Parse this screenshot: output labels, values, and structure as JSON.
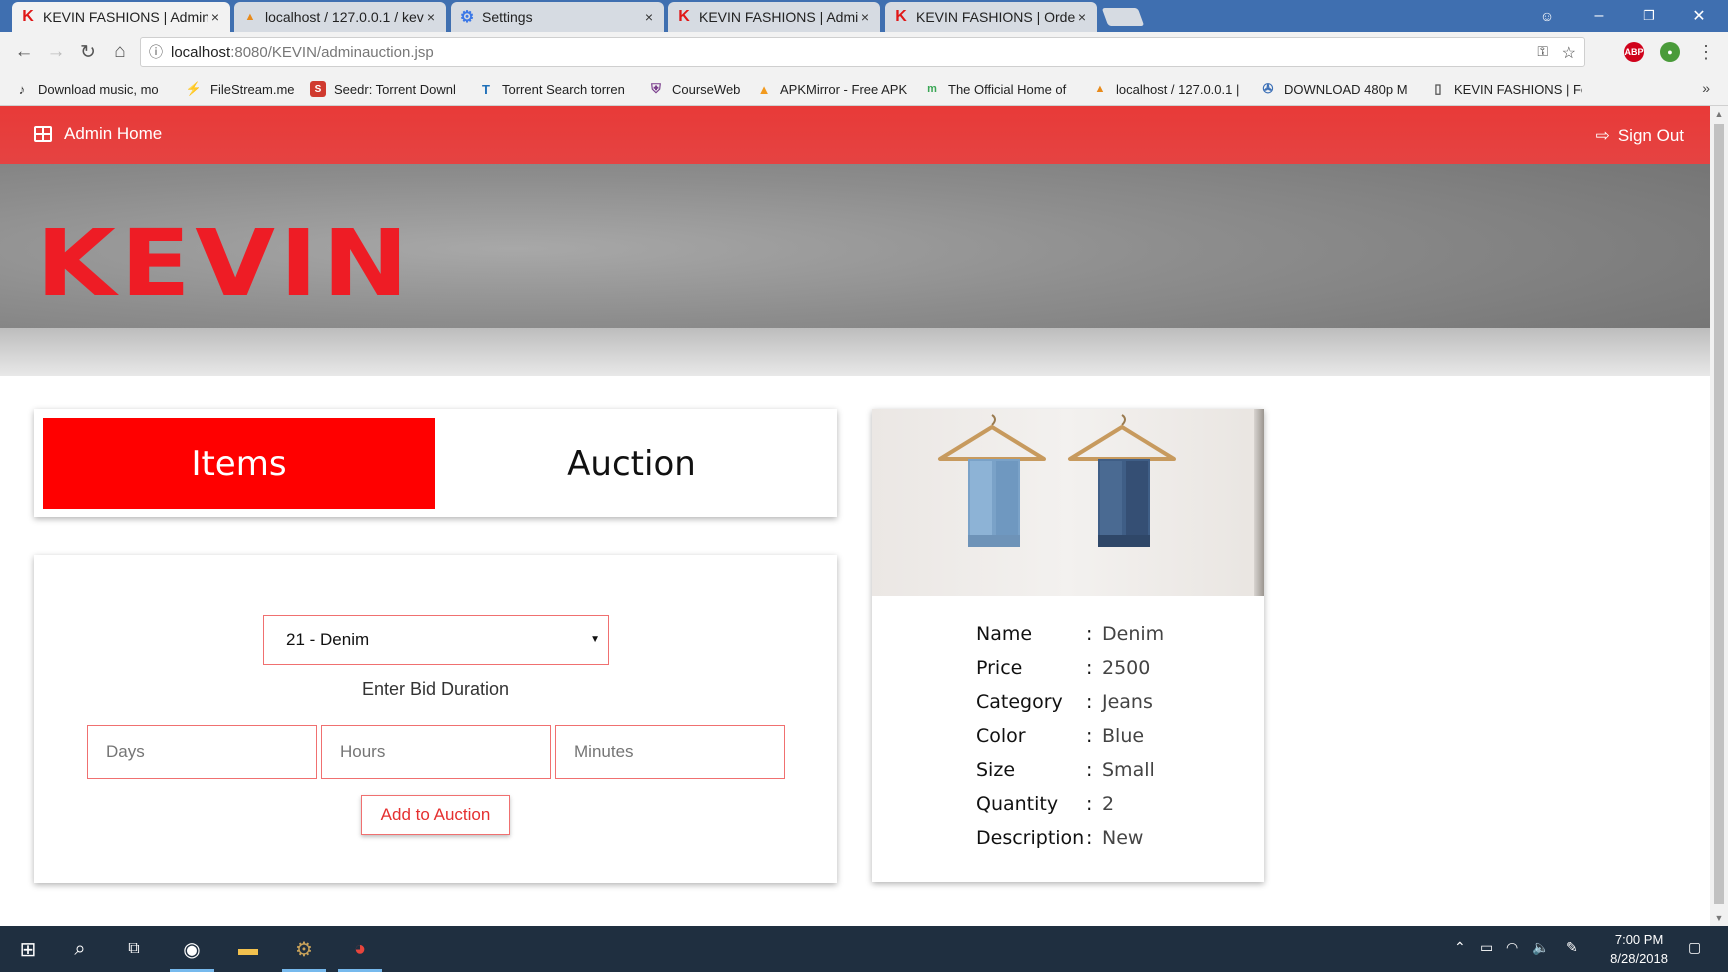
{
  "browser": {
    "tabs": [
      {
        "icon": "kevin-k-icon",
        "label": "KEVIN FASHIONS | Admin",
        "active": true
      },
      {
        "icon": "phpmyadmin-icon",
        "label": "localhost / 127.0.0.1 / kev",
        "active": false
      },
      {
        "icon": "gear-icon",
        "label": "Settings",
        "active": false
      },
      {
        "icon": "kevin-k-icon",
        "label": "KEVIN FASHIONS | Admin",
        "active": false
      },
      {
        "icon": "kevin-k-icon",
        "label": "KEVIN FASHIONS | Order",
        "active": false
      }
    ],
    "tab_close": "×",
    "address": {
      "host": "localhost",
      "path": ":8080/KEVIN/adminauction.jsp"
    },
    "bookmarks": [
      {
        "icon": "music-icon",
        "label": "Download music, mo"
      },
      {
        "icon": "bolt-icon",
        "label": "FileStream.me"
      },
      {
        "icon": "seedr-icon",
        "label": "Seedr: Torrent Downl"
      },
      {
        "icon": "t-icon",
        "label": "Torrent Search torren"
      },
      {
        "icon": "shield-icon",
        "label": "CourseWeb"
      },
      {
        "icon": "apkmirror-icon",
        "label": "APKMirror - Free APK"
      },
      {
        "icon": "m-icon",
        "label": "The Official Home of"
      },
      {
        "icon": "phpmyadmin-icon",
        "label": "localhost / 127.0.0.1 |"
      },
      {
        "icon": "film-icon",
        "label": "DOWNLOAD 480p M"
      },
      {
        "icon": "page-icon",
        "label": "KEVIN FASHIONS | Fe"
      }
    ],
    "bookmarks_more": "»"
  },
  "app": {
    "nav": {
      "home_label": "Admin Home",
      "signout_label": "Sign Out"
    },
    "logo_text": "KEVIN",
    "tabs": {
      "items_label": "Items",
      "auction_label": "Auction"
    },
    "form": {
      "selected_item": "21 - Denim",
      "duration_label": "Enter Bid Duration",
      "days_placeholder": "Days",
      "hours_placeholder": "Hours",
      "minutes_placeholder": "Minutes",
      "submit_label": "Add to Auction"
    },
    "product": {
      "fields": [
        {
          "key": "Name",
          "value": "Denim"
        },
        {
          "key": "Price",
          "value": "2500"
        },
        {
          "key": "Category",
          "value": "Jeans"
        },
        {
          "key": "Color",
          "value": "Blue"
        },
        {
          "key": "Size",
          "value": "Small"
        },
        {
          "key": "Quantity",
          "value": "2"
        },
        {
          "key": "Description",
          "value": "New"
        }
      ],
      "separator": ":"
    }
  },
  "colors": {
    "brand_red": "#e53e3c",
    "tab_active_red": "#ff0000",
    "input_border": "#f07070"
  },
  "taskbar": {
    "time": "7:00 PM",
    "date": "8/28/2018"
  }
}
